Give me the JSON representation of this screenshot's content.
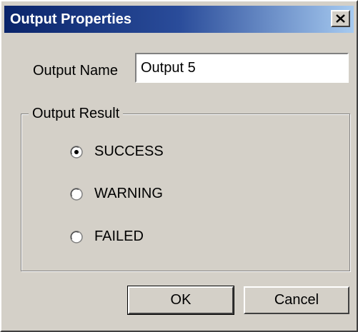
{
  "window": {
    "title": "Output Properties",
    "close_icon": "close-x-icon"
  },
  "form": {
    "name_label": "Output Name",
    "name_value": "Output 5"
  },
  "result_group": {
    "legend": "Output Result",
    "options": [
      {
        "label": "SUCCESS",
        "selected": true
      },
      {
        "label": "WARNING",
        "selected": false
      },
      {
        "label": "FAILED",
        "selected": false
      }
    ]
  },
  "buttons": {
    "ok_label": "OK",
    "cancel_label": "Cancel"
  },
  "colors": {
    "face": "#d4d0c8",
    "title_start": "#0a246a",
    "title_end": "#a6caf0"
  }
}
